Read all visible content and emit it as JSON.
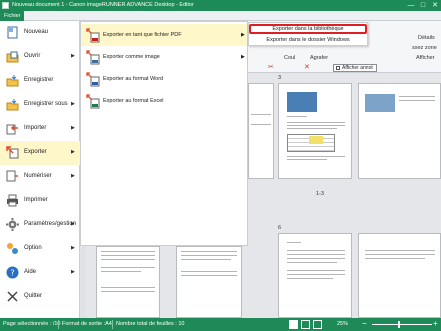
{
  "window": {
    "title": "Nouveau document 1 - Canon imageRUNNER ADVANCE Desktop - Editor",
    "minimize": "—",
    "maximize": "□",
    "close": "✕"
  },
  "ribbon": {
    "file_tab": "Fichier",
    "details_label": "Détails",
    "hide_zone_label": "ssez zone",
    "cut_label": "Coul",
    "paste_label": "Agrafer",
    "show_label": "Afficher",
    "show_annotations": "Afficher annot"
  },
  "left_menu": {
    "items": [
      {
        "label": "Nouveau",
        "icon": "new-document-icon",
        "has_submenu": false
      },
      {
        "label": "Ouvrir",
        "icon": "open-folder-icon",
        "has_submenu": true
      },
      {
        "label": "Enregistrer",
        "icon": "save-icon",
        "has_submenu": false
      },
      {
        "label": "Enregistrer sous",
        "icon": "save-as-icon",
        "has_submenu": true
      },
      {
        "label": "Importer",
        "icon": "import-icon",
        "has_submenu": true
      },
      {
        "label": "Exporter",
        "icon": "export-icon",
        "has_submenu": true,
        "selected": true
      },
      {
        "label": "Numériser",
        "icon": "scan-icon",
        "has_submenu": true
      },
      {
        "label": "Imprimer",
        "icon": "print-icon",
        "has_submenu": false
      },
      {
        "label": "Paramètres/gestion",
        "icon": "settings-icon",
        "has_submenu": true
      },
      {
        "label": "Option",
        "icon": "option-icon",
        "has_submenu": true
      },
      {
        "label": "Aide",
        "icon": "help-icon",
        "has_submenu": true
      },
      {
        "label": "Quitter",
        "icon": "quit-icon",
        "has_submenu": false
      }
    ]
  },
  "export_submenu": {
    "items": [
      {
        "label": "Exporter en tant que fichier PDF",
        "icon": "pdf-export-icon",
        "selected": true
      },
      {
        "label": "Exporter comme image",
        "icon": "image-export-icon"
      },
      {
        "label": "Exporter au format Word",
        "icon": "word-export-icon"
      },
      {
        "label": "Exporter au format Excel",
        "icon": "excel-export-icon"
      }
    ]
  },
  "pdf_flyout": {
    "items": [
      {
        "label": "Exporter dans la bibliothèque",
        "highlighted": true
      },
      {
        "label": "Exporter dans le dossier Windows"
      }
    ]
  },
  "document": {
    "page_label_top": "3",
    "page_range_label": "1-3",
    "page_label_bottom": "6"
  },
  "status": {
    "selected_pages": "Page sélectionnée : /10",
    "output_format": "Format de sortie :A4",
    "total_sheets": "Nombre total de feuilles : 10",
    "zoom": "25%",
    "zoom_out": "−",
    "zoom_in": "+"
  },
  "colors": {
    "accent_green": "#1d8a57",
    "selection_yellow": "#fdf7c9",
    "highlight_red": "#e02020"
  }
}
